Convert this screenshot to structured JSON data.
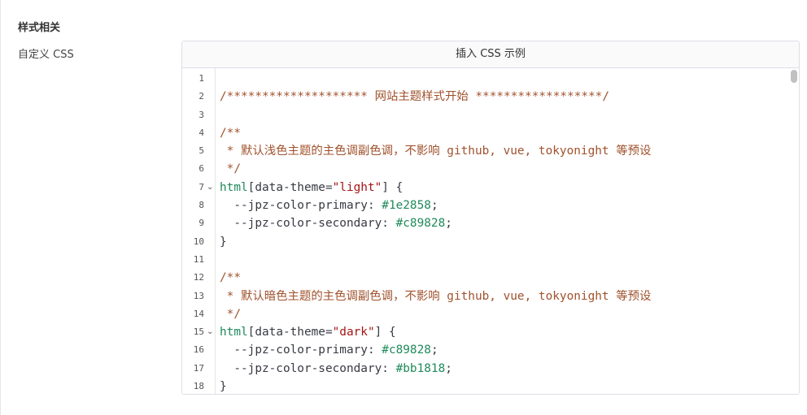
{
  "section": {
    "title": "样式相关"
  },
  "field": {
    "label": "自定义 CSS"
  },
  "editor": {
    "insert_button": "插入 CSS 示例",
    "lines": [
      {
        "n": "1",
        "fold": false,
        "tokens": []
      },
      {
        "n": "2",
        "fold": false,
        "tokens": [
          {
            "t": "/******************** 网站主题样式开始 ******************/",
            "c": "comment"
          }
        ]
      },
      {
        "n": "3",
        "fold": false,
        "tokens": []
      },
      {
        "n": "4",
        "fold": false,
        "tokens": [
          {
            "t": "/**",
            "c": "comment"
          }
        ]
      },
      {
        "n": "5",
        "fold": false,
        "tokens": [
          {
            "t": " * 默认浅色主题的主色调副色调，不影响 github, vue, tokyonight 等预设",
            "c": "comment"
          }
        ]
      },
      {
        "n": "6",
        "fold": false,
        "tokens": [
          {
            "t": " */",
            "c": "comment"
          }
        ]
      },
      {
        "n": "7",
        "fold": true,
        "tokens": [
          {
            "t": "html",
            "c": "sel"
          },
          {
            "t": "[",
            "c": "punc"
          },
          {
            "t": "data-theme",
            "c": "attr"
          },
          {
            "t": "=",
            "c": "punc"
          },
          {
            "t": "\"light\"",
            "c": "str"
          },
          {
            "t": "] {",
            "c": "punc"
          }
        ]
      },
      {
        "n": "8",
        "fold": false,
        "tokens": [
          {
            "t": "  --jpz-color-primary",
            "c": "prop"
          },
          {
            "t": ": ",
            "c": "punc"
          },
          {
            "t": "#1e2858",
            "c": "val"
          },
          {
            "t": ";",
            "c": "punc"
          }
        ]
      },
      {
        "n": "9",
        "fold": false,
        "tokens": [
          {
            "t": "  --jpz-color-secondary",
            "c": "prop"
          },
          {
            "t": ": ",
            "c": "punc"
          },
          {
            "t": "#c89828",
            "c": "val"
          },
          {
            "t": ";",
            "c": "punc"
          }
        ]
      },
      {
        "n": "10",
        "fold": false,
        "tokens": [
          {
            "t": "}",
            "c": "punc"
          }
        ]
      },
      {
        "n": "11",
        "fold": false,
        "tokens": []
      },
      {
        "n": "12",
        "fold": false,
        "tokens": [
          {
            "t": "/**",
            "c": "comment"
          }
        ]
      },
      {
        "n": "13",
        "fold": false,
        "tokens": [
          {
            "t": " * 默认暗色主题的主色调副色调，不影响 github, vue, tokyonight 等预设",
            "c": "comment"
          }
        ]
      },
      {
        "n": "14",
        "fold": false,
        "tokens": [
          {
            "t": " */",
            "c": "comment"
          }
        ]
      },
      {
        "n": "15",
        "fold": true,
        "tokens": [
          {
            "t": "html",
            "c": "sel"
          },
          {
            "t": "[",
            "c": "punc"
          },
          {
            "t": "data-theme",
            "c": "attr"
          },
          {
            "t": "=",
            "c": "punc"
          },
          {
            "t": "\"dark\"",
            "c": "str"
          },
          {
            "t": "] {",
            "c": "punc"
          }
        ]
      },
      {
        "n": "16",
        "fold": false,
        "tokens": [
          {
            "t": "  --jpz-color-primary",
            "c": "prop"
          },
          {
            "t": ": ",
            "c": "punc"
          },
          {
            "t": "#c89828",
            "c": "val"
          },
          {
            "t": ";",
            "c": "punc"
          }
        ]
      },
      {
        "n": "17",
        "fold": false,
        "tokens": [
          {
            "t": "  --jpz-color-secondary",
            "c": "prop"
          },
          {
            "t": ": ",
            "c": "punc"
          },
          {
            "t": "#bb1818",
            "c": "val"
          },
          {
            "t": ";",
            "c": "punc"
          }
        ]
      },
      {
        "n": "18",
        "fold": false,
        "tokens": [
          {
            "t": "}",
            "c": "punc"
          }
        ]
      }
    ]
  },
  "colors": {
    "comment": "#a0522d",
    "selector": "#1f8a5a",
    "string": "#a31515",
    "value": "#1f8a5a"
  },
  "icons": {
    "fold": "chevron-down-icon"
  }
}
